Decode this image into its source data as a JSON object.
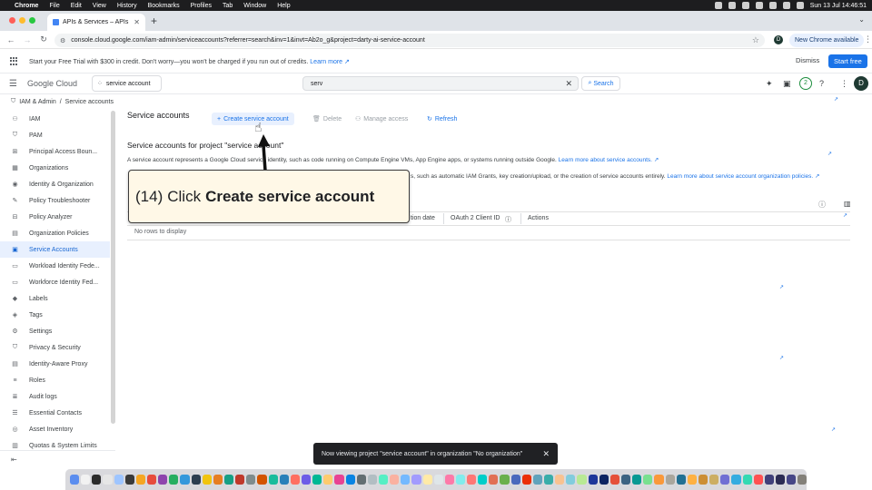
{
  "menubar": {
    "app": "Chrome",
    "items": [
      "File",
      "Edit",
      "View",
      "History",
      "Bookmarks",
      "Profiles",
      "Tab",
      "Window",
      "Help"
    ],
    "clock": "Sun 13 Jul  14:46:51"
  },
  "browser": {
    "tab_title": "APIs & Services – APIs & Se",
    "url": "console.cloud.google.com/iam-admin/serviceaccounts?referrer=search&inv=1&invt=Ab2o_g&project=darty-ai-service-account",
    "profile_initial": "D",
    "new_chrome_label": "New Chrome available"
  },
  "banner": {
    "message": "Start your Free Trial with $300 in credit. Don't worry—you won't be charged if you run out of credits.",
    "link": "Learn more",
    "dismiss": "Dismiss",
    "start": "Start free"
  },
  "header": {
    "logo": "Google Cloud",
    "project": "service account",
    "search_value": "serv",
    "search_button": "Search",
    "notifications": "2",
    "avatar": "D"
  },
  "breadcrumb": {
    "section": "IAM & Admin",
    "page": "Service accounts"
  },
  "sidebar": {
    "items": [
      {
        "label": "IAM",
        "icon": "person-add-icon"
      },
      {
        "label": "PAM",
        "icon": "shield-icon"
      },
      {
        "label": "Principal Access Boun...",
        "icon": "boundary-icon"
      },
      {
        "label": "Organizations",
        "icon": "grid-icon"
      },
      {
        "label": "Identity & Organization",
        "icon": "account-circle-icon"
      },
      {
        "label": "Policy Troubleshooter",
        "icon": "wrench-icon"
      },
      {
        "label": "Policy Analyzer",
        "icon": "analyzer-icon"
      },
      {
        "label": "Organization Policies",
        "icon": "document-icon"
      },
      {
        "label": "Service Accounts",
        "icon": "service-account-icon"
      },
      {
        "label": "Workload Identity Fede...",
        "icon": "workload-icon"
      },
      {
        "label": "Workforce Identity Fed...",
        "icon": "workforce-icon"
      },
      {
        "label": "Labels",
        "icon": "label-icon"
      },
      {
        "label": "Tags",
        "icon": "tag-icon"
      },
      {
        "label": "Settings",
        "icon": "gear-icon"
      },
      {
        "label": "Privacy & Security",
        "icon": "privacy-shield-icon"
      },
      {
        "label": "Identity-Aware Proxy",
        "icon": "proxy-icon"
      },
      {
        "label": "Roles",
        "icon": "roles-icon"
      },
      {
        "label": "Audit logs",
        "icon": "list-icon"
      },
      {
        "label": "Essential Contacts",
        "icon": "contacts-icon"
      },
      {
        "label": "Asset Inventory",
        "icon": "inventory-icon"
      },
      {
        "label": "Quotas & System Limits",
        "icon": "quota-icon"
      }
    ],
    "active_index": 8
  },
  "main": {
    "title": "Service accounts",
    "actions": {
      "create": "Create service account",
      "delete": "Delete",
      "manage": "Manage access",
      "refresh": "Refresh"
    },
    "subtitle": "Service accounts for project \"service account\"",
    "description": "A service account represents a Google Cloud service identity, such as code running on Compute Engine VMs, App Engine apps, or systems running outside Google.",
    "description_link": "Learn more about service accounts.",
    "description2": "s, such as automatic IAM Grants, key creation/upload, or the creation of service accounts entirely.",
    "description2_link": "Learn more about service account organization policies.",
    "columns": [
      "tion date",
      "OAuth 2 Client ID",
      "Actions"
    ],
    "empty": "No rows to display"
  },
  "callout": {
    "number": "(14)",
    "verb": "Click",
    "target": "Create service account"
  },
  "snackbar": {
    "message": "Now viewing project \"service account\" in organization \"No organization\""
  },
  "colors": {
    "accent": "#1a73e8",
    "active_bg": "#e8f0fe",
    "callout_bg": "#fff8e7"
  }
}
